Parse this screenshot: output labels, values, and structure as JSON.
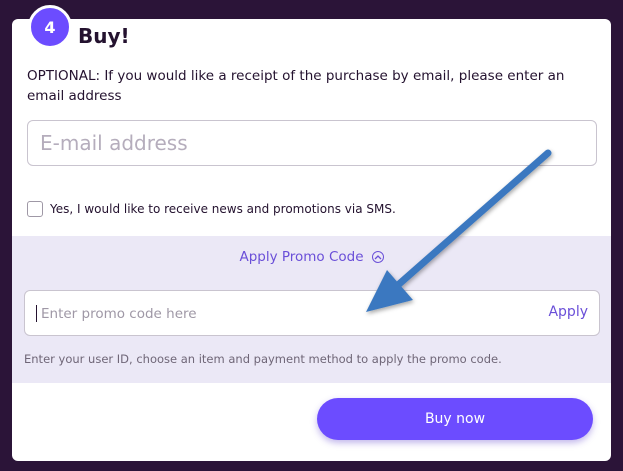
{
  "step": {
    "number": "4",
    "title": "Buy!"
  },
  "email_section": {
    "optional_text": "OPTIONAL: If you would like a receipt of the purchase by email, please enter an email address",
    "placeholder": "E-mail address",
    "value": ""
  },
  "sms_optin": {
    "label": "Yes, I would like to receive news and promotions via SMS.",
    "checked": false
  },
  "promo": {
    "toggle_label": "Apply Promo Code",
    "input_placeholder": "Enter promo code here",
    "input_value": "",
    "apply_label": "Apply",
    "hint": "Enter your user ID, choose an item and payment method to apply the promo code."
  },
  "buy_button": {
    "label": "Buy now"
  },
  "colors": {
    "accent": "#6c4cff",
    "link": "#6a4fd8",
    "page_background": "#2b1438",
    "promo_background": "#ebe8f6",
    "annotation_arrow": "#3a78c0"
  },
  "annotation": {
    "type": "arrow",
    "points_to": "promo-code-input"
  }
}
